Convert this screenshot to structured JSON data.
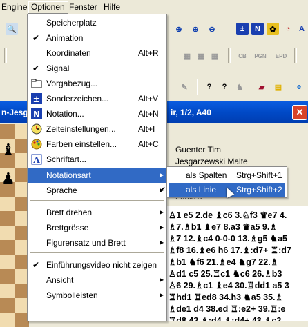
{
  "menubar": {
    "items": [
      {
        "label": "Engine"
      },
      {
        "label": "Optionen"
      },
      {
        "label": "Fenster"
      },
      {
        "label": "Hilfe"
      }
    ]
  },
  "titlebar": {
    "title_left": "n-Jesg",
    "title_right": "ir, 1/2, A40"
  },
  "players": {
    "white": "Guenter Tim",
    "black": "Jesgarzewski Malte",
    "caption": "Partie N"
  },
  "menu": {
    "items": [
      {
        "label": "Speicherplatz",
        "accel": "",
        "check": "",
        "icon": "",
        "submenu": false
      },
      {
        "label": "Animation",
        "accel": "",
        "check": "✔",
        "icon": "",
        "submenu": false
      },
      {
        "label": "Koordinaten",
        "accel": "Alt+R",
        "check": "",
        "icon": "",
        "submenu": false
      },
      {
        "label": "Signal",
        "accel": "",
        "check": "✔",
        "icon": "",
        "submenu": false
      },
      {
        "label": "Vorgabezug...",
        "accel": "",
        "check": "",
        "icon": "folder-icon",
        "submenu": false
      },
      {
        "label": "Sonderzeichen...",
        "accel": "Alt+V",
        "check": "",
        "icon": "special-chars-icon",
        "submenu": false
      },
      {
        "label": "Notation...",
        "accel": "Alt+N",
        "check": "",
        "icon": "notation-icon",
        "submenu": false
      },
      {
        "label": "Zeiteinstellungen...",
        "accel": "Alt+I",
        "check": "",
        "icon": "clock-icon",
        "submenu": false
      },
      {
        "label": "Farben einstellen...",
        "accel": "Alt+C",
        "check": "",
        "icon": "palette-icon",
        "submenu": false
      },
      {
        "label": "Schriftart...",
        "accel": "",
        "check": "",
        "icon": "font-icon",
        "submenu": false
      },
      {
        "label": "Notationsart",
        "accel": "",
        "check": "",
        "icon": "",
        "submenu": true
      },
      {
        "label": "Sprache",
        "accel": "",
        "check": "",
        "icon": "",
        "submenu": true
      },
      {
        "label": "Brett drehen",
        "accel": "",
        "check": "",
        "icon": "",
        "submenu": true
      },
      {
        "label": "Brettgrösse",
        "accel": "",
        "check": "",
        "icon": "",
        "submenu": true
      },
      {
        "label": "Figurensatz und Brett",
        "accel": "",
        "check": "",
        "icon": "",
        "submenu": true
      },
      {
        "label": "Einführungsvideo nicht zeigen",
        "accel": "",
        "check": "✔",
        "icon": "",
        "submenu": false
      },
      {
        "label": "Ansicht",
        "accel": "",
        "check": "",
        "icon": "",
        "submenu": true
      },
      {
        "label": "Symbolleisten",
        "accel": "",
        "check": "",
        "icon": "",
        "submenu": true
      }
    ]
  },
  "submenu": {
    "items": [
      {
        "label": "als Spalten",
        "accel": "Strg+Shift+1",
        "check": ""
      },
      {
        "label": "als Linie",
        "accel": "Strg+Shift+2",
        "check": "✔"
      }
    ]
  },
  "notation": {
    "lines": [
      "♙1 e5 2.de ♝c6 3.♘f3 ♛e7 4.",
      "♗7.♗b1 ♝e7 8.a3 ♛a5 9.♗",
      "♗7 12.♝c4 0-0-0 13.♗g5 ♞a5",
      "♗f8 16.♝e6 h6 17.♝:d7+ ♖:d7",
      "♗b1 ♞f6 21.♗e4 ♞g7 22.♗",
      "♙d1 c5 25.♖c1 ♞c6 26.♗b3",
      "♙6 29.♗c1 ♝e4 30.♖dd1 a5 3",
      "♖hd1 ♖ed8 34.h3 ♞a5 35.♗",
      "♗de1 d4 38.ed ♖:e2+ 39.♖:e",
      "♖d8 42.♗:d4 ♗:d4+ 43.♗c2"
    ]
  },
  "colors": {
    "menu_highlight": "#316ac5",
    "titlebar": "#0049c6",
    "board_light": "#f1dcb0",
    "board_dark": "#b88a55"
  }
}
